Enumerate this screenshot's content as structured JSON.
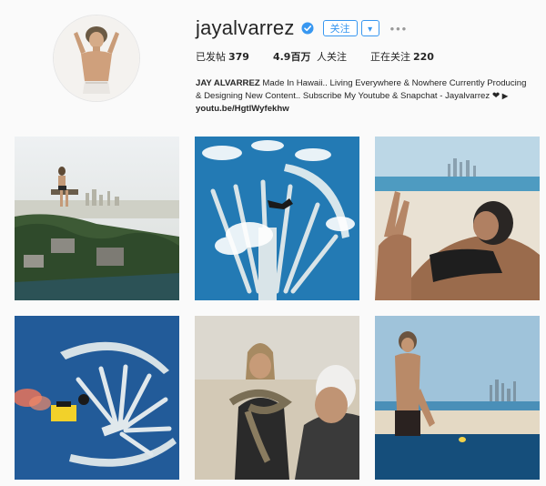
{
  "profile": {
    "username": "jayalvarrez",
    "follow_label": "关注",
    "dropdown_label": "▾",
    "options_label": "•••",
    "stats": [
      {
        "label": "已发帖",
        "value": "379"
      },
      {
        "label": "4.9百万",
        "value": "人关注"
      },
      {
        "label": "正在关注",
        "value": "220"
      }
    ],
    "bio_name": "JAY ALVARREZ",
    "bio_text": " Made In Hawaii.. Living Everywhere & Nowhere Currently Producing & Designing New Content.. Subscribe My Youtube & Snapchat - Jayalvarrez ",
    "bio_link": "youtu.be/HgtlWyfekhw"
  },
  "colors": {
    "verified": "#3897f0",
    "button_blue": "#3897f0",
    "background": "#fafafa"
  },
  "posts": [
    {
      "name": "cliff-sunset-city"
    },
    {
      "name": "palm-island-aerial-skydiver"
    },
    {
      "name": "beach-selfie-skyline"
    },
    {
      "name": "palm-island-jetpack"
    },
    {
      "name": "desert-snake"
    },
    {
      "name": "infinity-pool-skyline"
    }
  ]
}
